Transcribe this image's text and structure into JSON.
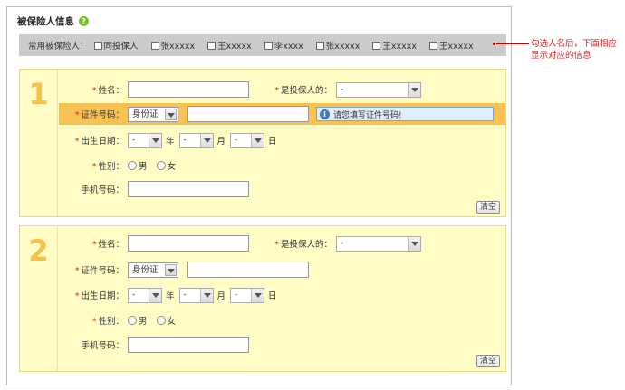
{
  "section_title": "被保险人信息",
  "help_icon": "question-icon",
  "frequent": {
    "label": "常用被保险人：",
    "options": [
      "同投保人",
      "张xxxxx",
      "王xxxxx",
      "李xxxx",
      "张xxxxx",
      "王xxxxx",
      "王xxxxx"
    ]
  },
  "annotation": {
    "line1": "勾选人名后，下面相应",
    "line2": "显示对应的信息"
  },
  "insured": [
    {
      "index": "1",
      "name_label": "姓名：",
      "relation_label": "是投保人的：",
      "relation_value": "-",
      "id_label": "证件号码：",
      "id_type": "身份证",
      "id_hint": "请您填写证件号码!",
      "dob_label": "出生日期：",
      "year_value": "-",
      "year_unit": "年",
      "month_value": "-",
      "month_unit": "月",
      "day_value": "-",
      "day_unit": "日",
      "gender_label": "性别：",
      "male": "男",
      "female": "女",
      "phone_label": "手机号码：",
      "clear_label": "清空"
    },
    {
      "index": "2",
      "name_label": "姓名：",
      "relation_label": "是投保人的：",
      "relation_value": "-",
      "id_label": "证件号码：",
      "id_type": "身份证",
      "dob_label": "出生日期：",
      "year_value": "-",
      "year_unit": "年",
      "month_value": "-",
      "month_unit": "月",
      "day_value": "-",
      "day_unit": "日",
      "gender_label": "性别：",
      "male": "男",
      "female": "女",
      "phone_label": "手机号码：",
      "clear_label": "清空"
    }
  ],
  "required_mark": "*",
  "colors": {
    "card_bg": "#fffcc6",
    "highlight": "#f8c253",
    "index_digit": "#f5c04c",
    "annotation": "#e02020"
  }
}
